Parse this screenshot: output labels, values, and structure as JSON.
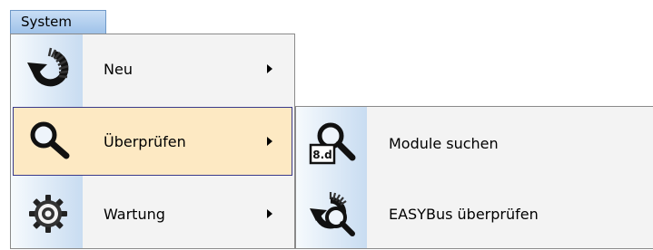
{
  "menubar": {
    "system_label": "System"
  },
  "menu": {
    "items": [
      {
        "label": "Neu",
        "icon": "refresh-arrow-icon",
        "has_submenu": true,
        "active": false
      },
      {
        "label": "Überprüfen",
        "icon": "magnifier-icon",
        "has_submenu": true,
        "active": true
      },
      {
        "label": "Wartung",
        "icon": "gear-icon",
        "has_submenu": true,
        "active": false
      }
    ]
  },
  "submenu": {
    "items": [
      {
        "label": "Module suchen",
        "icon": "module-search-icon",
        "icon_text": "8.d"
      },
      {
        "label": "EASYBus überprüfen",
        "icon": "bus-check-icon"
      }
    ]
  },
  "colors": {
    "highlight": "#fde9c3",
    "highlight_border": "#3a3a8a",
    "menubar": "#9fc2e9"
  }
}
